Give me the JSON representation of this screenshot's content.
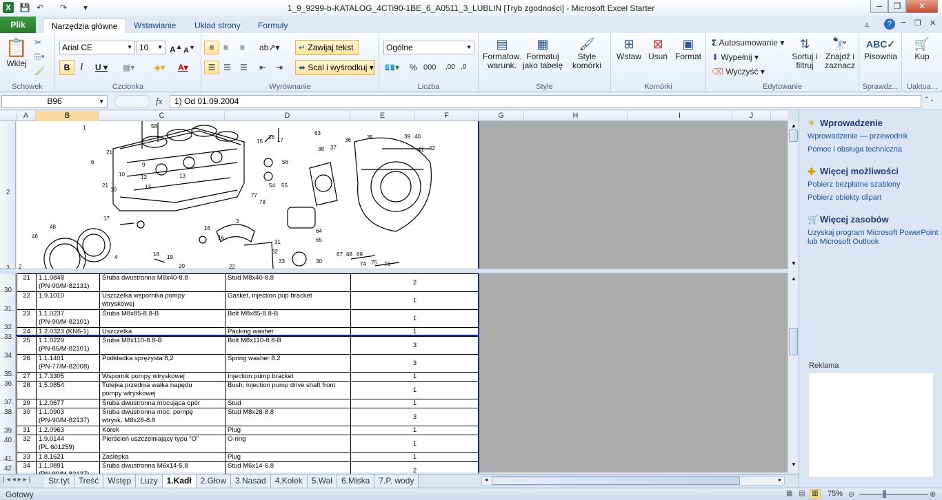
{
  "window": {
    "title": "1_9_9299-b-KATALOG_4CTi90-1BE_6_A0511_3_LUBLIN  [Tryb zgodności]  -  Microsoft Excel Starter"
  },
  "tabs": {
    "file": "Plik",
    "items": [
      "Narzędzia główne",
      "Wstawianie",
      "Układ strony",
      "Formuły"
    ]
  },
  "ribbon": {
    "clipboard": {
      "paste": "Wklej",
      "group": "Schowek"
    },
    "font": {
      "name": "Arial CE",
      "size": "10",
      "group": "Czcionka"
    },
    "alignment": {
      "wrap": "Zawijaj tekst",
      "merge": "Scal i wyśrodkuj",
      "group": "Wyrównanie"
    },
    "number": {
      "format": "Ogólne",
      "group": "Liczba"
    },
    "styles": {
      "cond": "Formatow.\nwarunk.",
      "table": "Formatuj\njako tabelę",
      "cell": "Style\nkomórki",
      "group": "Style"
    },
    "cells": {
      "insert": "Wstaw",
      "delete": "Usuń",
      "format": "Format",
      "group": "Komórki"
    },
    "editing": {
      "autosum": "Autosumowanie",
      "fill": "Wypełnij",
      "clear": "Wyczyść",
      "sort": "Sortuj i\nfiltruj",
      "find": "Znajdź i\nzaznacz",
      "group": "Edytowanie"
    },
    "proofing": {
      "spelling": "Pisownia",
      "group": "Sprawdz..."
    },
    "upgrade": {
      "buy": "Kup",
      "group": "Uaktua..."
    }
  },
  "formula_bar": {
    "name_box": "B96",
    "fx": "fx",
    "content": "1) Od 01.09.2004"
  },
  "columns": [
    "A",
    "B",
    "C",
    "D",
    "E",
    "F",
    "G",
    "H",
    "I",
    "J"
  ],
  "drawing_labels": [
    "1",
    "58",
    "21",
    "6",
    "10",
    "21",
    "9",
    "12",
    "13",
    "11",
    "10",
    "17",
    "18",
    "19",
    "20",
    "16",
    "15",
    "14",
    "16",
    "17",
    "56",
    "63",
    "38",
    "37",
    "36",
    "35",
    "39",
    "40",
    "41",
    "42",
    "48",
    "46",
    "4",
    "3",
    "54",
    "55",
    "77",
    "78",
    "3",
    "16",
    "22",
    "31",
    "32",
    "33",
    "30",
    "64",
    "65",
    "67",
    "68",
    "69",
    "74",
    "75",
    "76",
    "2"
  ],
  "rows": [
    {
      "row": "30",
      "no": "21",
      "code": "1.1.0848\n(PN-90/M-82131)",
      "pl": "Śruba dwustronna M8x40-8.8",
      "en": "Stud M8x40-8.8",
      "qty": "2"
    },
    {
      "row": "31",
      "no": "22",
      "code": "1.9.1010",
      "pl": "Uszczelka wspornika pompy\nwtryskowej",
      "en": "Gasket, injection pup bracket",
      "qty": "1"
    },
    {
      "row": "32",
      "no": "23",
      "code": "1.1.0237\n(PN-90/M-82101)",
      "pl": "Śruba M8x85-8.8-B",
      "en": "Bolt M8x85-8.8-B",
      "qty": "1"
    },
    {
      "row": "33",
      "no": "24",
      "code": "1.2.0323 (KN6-1)",
      "pl": "Uszczelka",
      "en": "Packing washer",
      "qty": "1"
    },
    {
      "row": "34",
      "no": "25",
      "code": "1.1.0229\n(PN-85/M-82101)",
      "pl": "Śruba M8x110-8.8-B",
      "en": "Bolt M8x110-8.8-B",
      "qty": "3"
    },
    {
      "row": "35",
      "no": "26",
      "code": "1.1.1401\n(PN-77/M-82008)",
      "pl": "Podkładka sprężysta 8,2",
      "en": "Spring washer 8.2",
      "qty": "3"
    },
    {
      "row": "36",
      "no": "27",
      "code": "1.7.3305",
      "pl": "Wspornik pompy wtryskowej",
      "en": "Injection pump bracket",
      "qty": "1"
    },
    {
      "row": "37",
      "no": "28",
      "code": "1.5.0854",
      "pl": "Tulejka przednia wałka napędu\npompy wtryskowej",
      "en": "Bush, injection pump drive shaft front",
      "qty": "1"
    },
    {
      "row": "38",
      "no": "29",
      "code": "1.2.0677",
      "pl": "Śruba dwustronna mocująca opór",
      "en": "Stud",
      "qty": "1"
    },
    {
      "row": "39",
      "no": "30",
      "code": "1.1.0903\n(PN-90/M-82137)",
      "pl": "Śruba dwustronna moc. pompę\nwtrysk. M8x28-8.8",
      "en": "Stud M8x28-8.8",
      "qty": "3"
    },
    {
      "row": "40",
      "no": "31",
      "code": "1.2.0963",
      "pl": "Korek",
      "en": "Plug",
      "qty": "1"
    },
    {
      "row": "41",
      "no": "32",
      "code": "1.9.0144\n(PL 601259)",
      "pl": "Pierścień uszczelniający typu \"O\"",
      "en": "O-ring",
      "qty": "1"
    },
    {
      "row": "42",
      "no": "33",
      "code": "1.8.1621",
      "pl": "Zaślepka",
      "en": "Plug",
      "qty": "1"
    },
    {
      "row": "43",
      "no": "34",
      "code": "1.1.0891\n(PN-90/M-82137)",
      "pl": "Śruba dwustronna M6x14-5,8",
      "en": "Stud M6x14-5.8",
      "qty": "2"
    }
  ],
  "sheet_tabs": [
    "Str.tyt",
    "Treść",
    "Wstęp",
    "Luzy",
    "1.Kadł",
    "2.Głow",
    "3.Nasad",
    "4.Kolek",
    "5.Wał",
    "6.Miska",
    "7.P. wody"
  ],
  "active_sheet": "1.Kadł",
  "status": {
    "ready": "Gotowy",
    "zoom": "75%"
  },
  "side_pane": {
    "intro_head": "Wprowadzenie",
    "intro_links": [
      "Wprowadzenie — przewodnik",
      "Pomoc i obsługa techniczna"
    ],
    "more_head": "Więcej możliwości",
    "more_links": [
      "Pobierz bezpłatne szablony",
      "Pobierz obiekty clipart"
    ],
    "res_head": "Więcej zasobów",
    "res_links": [
      "Uzyskaj program Microsoft PowerPoint lub Microsoft Outlook"
    ],
    "ad_label": "Reklama"
  }
}
